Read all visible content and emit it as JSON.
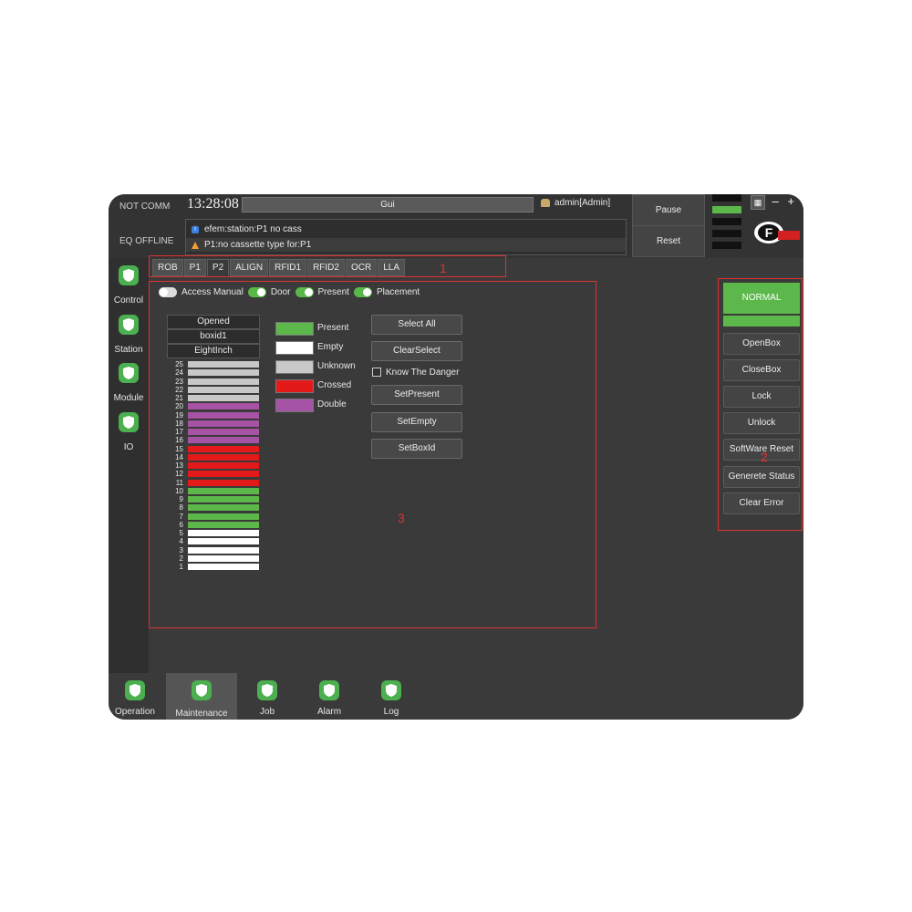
{
  "header": {
    "comm_status": "NOT COMM",
    "eq_status": "EQ OFFLINE",
    "clock": "13:28:08",
    "gui_label": "Gui",
    "user": "admin[Admin]",
    "pause_label": "Pause",
    "reset_label": "Reset",
    "messages": [
      {
        "type": "info",
        "text": "efem:station:P1 no cass"
      },
      {
        "type": "warning",
        "text": "P1:no cassette type for:P1"
      }
    ],
    "window_buttons": [
      "–",
      "+"
    ]
  },
  "sidebar": {
    "items": [
      {
        "label": "Control"
      },
      {
        "label": "Station"
      },
      {
        "label": "Module"
      },
      {
        "label": "IO"
      }
    ]
  },
  "tabs": [
    {
      "label": "ROB",
      "active": false
    },
    {
      "label": "P1",
      "active": false
    },
    {
      "label": "P2",
      "active": true
    },
    {
      "label": "ALIGN",
      "active": false
    },
    {
      "label": "RFID1",
      "active": false
    },
    {
      "label": "RFID2",
      "active": false
    },
    {
      "label": "OCR",
      "active": false
    },
    {
      "label": "LLA",
      "active": false
    }
  ],
  "annotations": {
    "tabs": "1",
    "right_panel": "2",
    "main_panel": "3"
  },
  "toggles": [
    {
      "label": "Access Manual",
      "on": false
    },
    {
      "label": "Door",
      "on": true
    },
    {
      "label": "Present",
      "on": true
    },
    {
      "label": "Placement",
      "on": true
    }
  ],
  "cassette": {
    "state": "Opened",
    "box_id": "boxid1",
    "type": "EightInch",
    "slots": [
      {
        "num": "25",
        "status": "Unknown"
      },
      {
        "num": "24",
        "status": "Unknown"
      },
      {
        "num": "23",
        "status": "Unknown"
      },
      {
        "num": "22",
        "status": "Unknown"
      },
      {
        "num": "21",
        "status": "Unknown"
      },
      {
        "num": "20",
        "status": "Double"
      },
      {
        "num": "19",
        "status": "Double"
      },
      {
        "num": "18",
        "status": "Double"
      },
      {
        "num": "17",
        "status": "Double"
      },
      {
        "num": "16",
        "status": "Double"
      },
      {
        "num": "15",
        "status": "Crossed"
      },
      {
        "num": "14",
        "status": "Crossed"
      },
      {
        "num": "13",
        "status": "Crossed"
      },
      {
        "num": "12",
        "status": "Crossed"
      },
      {
        "num": "11",
        "status": "Crossed"
      },
      {
        "num": "10",
        "status": "Present"
      },
      {
        "num": "9",
        "status": "Present"
      },
      {
        "num": "8",
        "status": "Present"
      },
      {
        "num": "7",
        "status": "Present"
      },
      {
        "num": "6",
        "status": "Present"
      },
      {
        "num": "5",
        "status": "Empty"
      },
      {
        "num": "4",
        "status": "Empty"
      },
      {
        "num": "3",
        "status": "Empty"
      },
      {
        "num": "2",
        "status": "Empty"
      },
      {
        "num": "1",
        "status": "Empty"
      }
    ]
  },
  "legend": [
    {
      "label": "Present",
      "color": "#5cb84a"
    },
    {
      "label": "Empty",
      "color": "#ffffff"
    },
    {
      "label": "Unknown",
      "color": "#c8c8c8"
    },
    {
      "label": "Crossed",
      "color": "#e41a1a"
    },
    {
      "label": "Double",
      "color": "#a653a6"
    }
  ],
  "actions": {
    "select_all": "Select All",
    "clear_select": "ClearSelect",
    "know_danger": "Know The Danger",
    "set_present": "SetPresent",
    "set_empty": "SetEmpty",
    "set_box_id": "SetBoxId"
  },
  "right_panel": {
    "status": "NORMAL",
    "status_color": "#5cb84a",
    "buttons": [
      "OpenBox",
      "CloseBox",
      "Lock",
      "Unlock",
      "SoftWare Reset",
      "Generete Status",
      "Clear Error"
    ]
  },
  "bottom_nav": [
    {
      "label": "Operation",
      "active": false
    },
    {
      "label": "Maintenance",
      "active": true
    },
    {
      "label": "Job",
      "active": false
    },
    {
      "label": "Alarm",
      "active": false
    },
    {
      "label": "Log",
      "active": false
    }
  ]
}
